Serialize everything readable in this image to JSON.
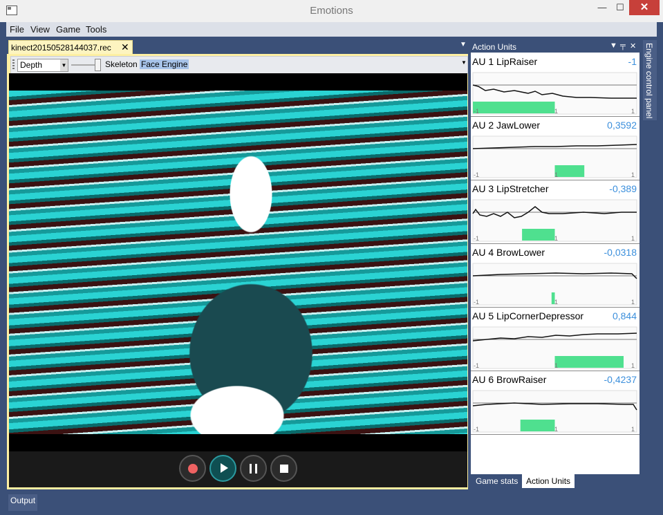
{
  "window": {
    "title": "Emotions",
    "minimize": "—",
    "maximize": "☐",
    "close": "✕"
  },
  "menu": [
    "File",
    "View",
    "Game",
    "Tools"
  ],
  "document": {
    "tab_title": "kinect20150528144037.rec",
    "tab_close": "✕",
    "view_mode": "Depth",
    "toolbar_items": [
      "Skeleton",
      "Face",
      "Engine"
    ]
  },
  "action_units": {
    "panel_title": "Action Units",
    "items": [
      {
        "label": "AU 1 LipRaiser",
        "value": "-1",
        "bar": [
          0.0,
          0.5
        ]
      },
      {
        "label": "AU 2 JawLower",
        "value": "0,3592",
        "bar": [
          0.5,
          0.68
        ]
      },
      {
        "label": "AU 3 LipStretcher",
        "value": "-0,389",
        "bar": [
          0.3,
          0.5
        ]
      },
      {
        "label": "AU 4 BrowLower",
        "value": "-0,0318",
        "bar": [
          0.48,
          0.5
        ]
      },
      {
        "label": "AU 5 LipCornerDepressor",
        "value": "0,844",
        "bar": [
          0.5,
          0.92
        ]
      },
      {
        "label": "AU 6 BrowRaiser",
        "value": "-0,4237",
        "bar": [
          0.29,
          0.5
        ]
      }
    ],
    "axis_labels": [
      "-1",
      "1",
      "1"
    ]
  },
  "bottom_tabs": [
    "Game stats",
    "Action Units"
  ],
  "side_panel": "Engine control panel",
  "output_tab": "Output",
  "colors": {
    "accent": "#3b8fdc",
    "bar": "#4fe08f",
    "chrome": "#3b5078",
    "doc_tab": "#fdf4c0"
  }
}
